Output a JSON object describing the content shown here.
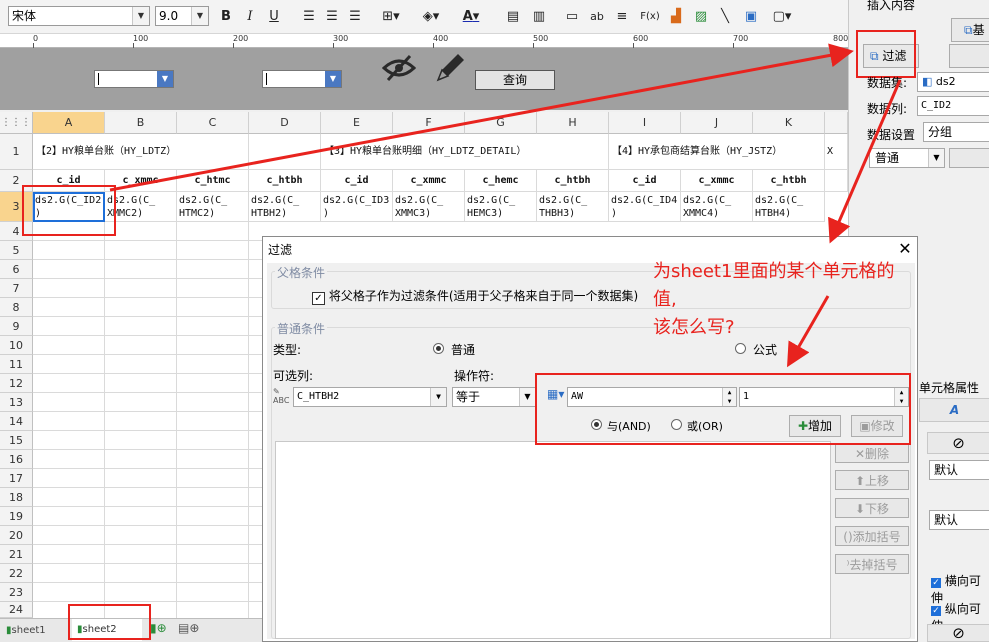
{
  "toolbar": {
    "font_name": "宋体",
    "font_size": "9.0",
    "bold": "B",
    "italic": "I",
    "underline": "U",
    "text_color_glyph": "A",
    "text_icon_glyph": "ab",
    "formula_glyph": "F(x)"
  },
  "ruler": {
    "marks": [
      "0",
      "100",
      "200",
      "300",
      "400",
      "500",
      "600",
      "700",
      "800"
    ]
  },
  "param_band": {
    "query_button": "查询"
  },
  "columns": [
    "A",
    "B",
    "C",
    "D",
    "E",
    "F",
    "G",
    "H",
    "I",
    "J",
    "K"
  ],
  "rows": [
    "1",
    "2",
    "3",
    "4",
    "5",
    "6",
    "7",
    "8",
    "9",
    "10",
    "11",
    "12",
    "13",
    "14",
    "15",
    "16",
    "17",
    "18",
    "19",
    "20",
    "21",
    "22",
    "23",
    "24"
  ],
  "row1": {
    "a": "【2】HY粮单台账（HY_LDTZ）",
    "e": "【3】HY粮单台账明细（HY_LDTZ_DETAIL）",
    "i": "【4】HY承包商结算台账（HY_JSTZ）",
    "l": "X"
  },
  "row2": [
    "c_id",
    "c_xmmc",
    "c_htmc",
    "c_htbh",
    "c_id",
    "c_xmmc",
    "c_hemc",
    "c_htbh",
    "c_id",
    "c_xmmc",
    "c_htbh"
  ],
  "row3": [
    [
      "ds2.G(C_ID2",
      ")"
    ],
    [
      "ds2.G(C_",
      "XMMC2)"
    ],
    [
      "ds2.G(C_",
      "HTMC2)"
    ],
    [
      "ds2.G(C_",
      "HTBH2)"
    ],
    [
      "ds2.G(C_ID3",
      ")"
    ],
    [
      "ds2.G(C_",
      "XMMC3)"
    ],
    [
      "ds2.G(C_",
      "HEMC3)"
    ],
    [
      "ds2.G(C_",
      "THBH3)"
    ],
    [
      "ds2.G(C_ID4",
      ")"
    ],
    [
      "ds2.G(C_",
      "XMMC4)"
    ],
    [
      "ds2.G(C_",
      "HTBH4)"
    ]
  ],
  "sheets": {
    "sheet1": "sheet1",
    "sheet2": "sheet2"
  },
  "right_panel": {
    "insert_content": "插入内容",
    "top_button_partial": "基",
    "filter_button": "过滤",
    "dataset_label": "数据集:",
    "dataset_value": "ds2",
    "datacol_label": "数据列:",
    "datacol_value": "C_ID2",
    "dataset_settings_label": "数据设置",
    "dataset_settings_value": "分组",
    "mode_value": "普通",
    "cell_props_title": "单元格属性表",
    "font_icon_glyph": "A",
    "default1": "默认",
    "default2": "默认",
    "check1": "横向可伸",
    "check2": "纵向可伸"
  },
  "dialog": {
    "title": "过滤",
    "parent_group_label": "父格条件",
    "parent_checkbox_label": "将父格子作为过滤条件(适用于父子格来自于同一个数据集)",
    "normal_group_label": "普通条件",
    "type_label": "类型:",
    "type_normal": "普通",
    "type_formula": "公式",
    "column_label": "可选列:",
    "operator_label": "操作符:",
    "column_value": "C_HTBH2",
    "operator_value": "等于",
    "value_input": "AW",
    "value_input2": "1",
    "and_label": "与(AND)",
    "or_label": "或(OR)",
    "add_button": "增加",
    "edit_button": "修改",
    "delete_button": "删除",
    "up_button": "上移",
    "down_button": "下移",
    "add_bracket_button": "添加括号",
    "remove_bracket_button": "去掉括号"
  },
  "annotation": {
    "line1": "为sheet1里面的某个单元格的",
    "line2": "值,",
    "line3": "该怎么写?"
  },
  "colors": {
    "annotation_red": "#e8231e",
    "selection_blue": "#1e6fd9",
    "band_gray": "#a0a0a0"
  }
}
